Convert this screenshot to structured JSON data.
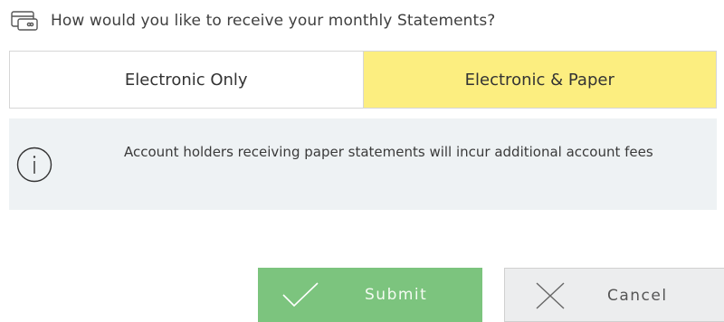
{
  "question": {
    "icon": "card-statement-icon",
    "text": "How would you like to receive your monthly Statements?"
  },
  "delivery_options": {
    "options": [
      {
        "label": "Electronic Only",
        "selected": false
      },
      {
        "label": "Electronic & Paper",
        "selected": true
      }
    ],
    "selected_color": "#fcee80"
  },
  "notice": {
    "icon": "info-icon",
    "text": "Account holders receiving paper statements will incur additional account fees",
    "background": "#eef2f4"
  },
  "actions": {
    "submit_label": "Submit",
    "submit_icon": "checkmark-icon",
    "submit_color": "#7cc47e",
    "cancel_label": "Cancel",
    "cancel_icon": "close-icon",
    "cancel_color": "#ecedee"
  }
}
